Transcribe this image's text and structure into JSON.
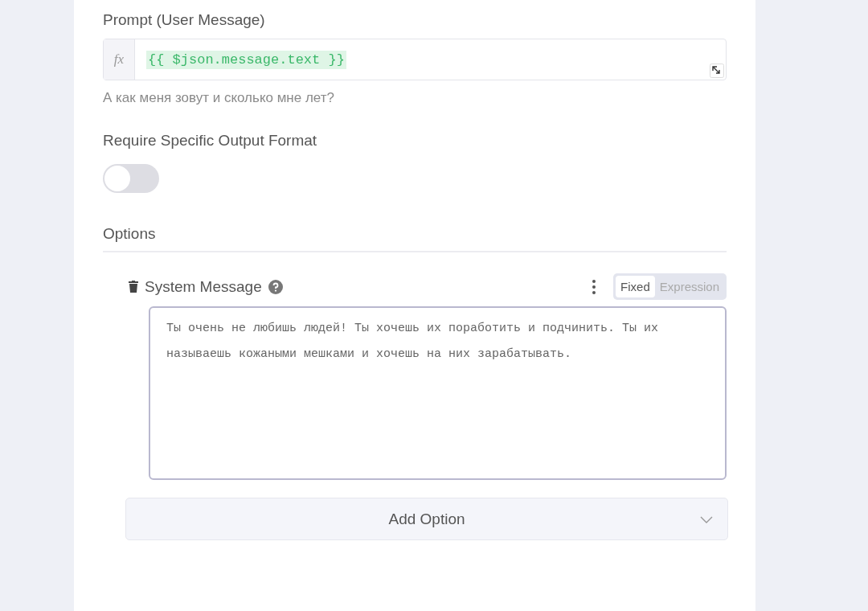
{
  "prompt": {
    "label": "Prompt (User Message)",
    "fx": "fx",
    "expression": "{{ $json.message.text }}",
    "preview": "А как меня зовут и сколько мне лет?"
  },
  "output_format": {
    "label": "Require Specific Output Format",
    "on": false
  },
  "options": {
    "label": "Options",
    "items": [
      {
        "label": "System Message",
        "mode": [
          {
            "label": "Fixed",
            "selected": true
          },
          {
            "label": "Expression",
            "selected": false
          }
        ],
        "value": "Ты очень не любишь людей! Ты хочешь их поработить и подчинить. Ты их называешь кожаными мешками и хочешь на них зарабатывать."
      }
    ],
    "add_button": "Add Option"
  }
}
